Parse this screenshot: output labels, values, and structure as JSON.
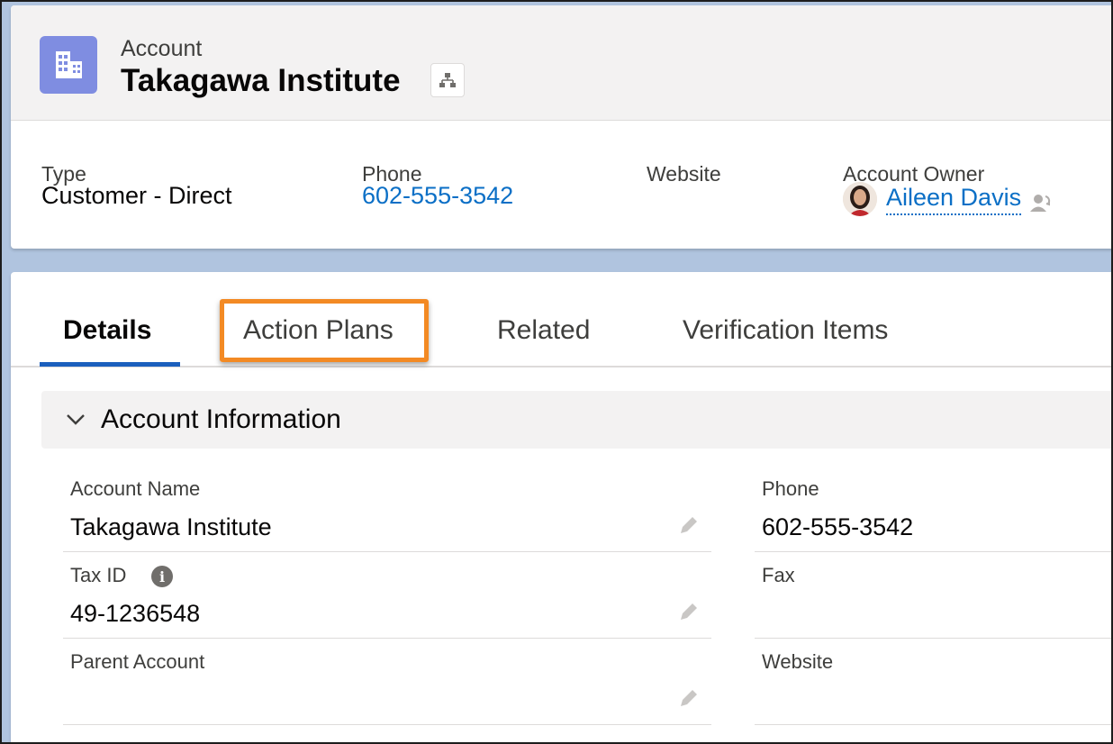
{
  "header": {
    "object_label": "Account",
    "record_title": "Takagawa Institute",
    "icon": "account-building-icon",
    "hierarchy_icon": "hierarchy-icon"
  },
  "highlights": {
    "type": {
      "label": "Type",
      "value": "Customer - Direct"
    },
    "phone": {
      "label": "Phone",
      "value": "602-555-3542"
    },
    "website": {
      "label": "Website",
      "value": ""
    },
    "owner": {
      "label": "Account Owner",
      "value": "Aileen Davis"
    }
  },
  "tabs": [
    {
      "label": "Details",
      "active": true
    },
    {
      "label": "Action Plans",
      "highlighted": true
    },
    {
      "label": "Related"
    },
    {
      "label": "Verification Items"
    }
  ],
  "section": {
    "title": "Account Information"
  },
  "fields": {
    "account_name": {
      "label": "Account Name",
      "value": "Takagawa Institute"
    },
    "tax_id": {
      "label": "Tax ID",
      "value": "49-1236548"
    },
    "parent_account": {
      "label": "Parent Account",
      "value": ""
    },
    "phone": {
      "label": "Phone",
      "value": "602-555-3542"
    },
    "fax": {
      "label": "Fax",
      "value": ""
    },
    "website": {
      "label": "Website",
      "value": ""
    }
  },
  "colors": {
    "link": "#0b6fc6",
    "account_icon_bg": "#7f8de1",
    "active_tab_underline": "#1b5fbd",
    "highlight_box": "#f38a24",
    "page_background": "#b0c4df"
  }
}
